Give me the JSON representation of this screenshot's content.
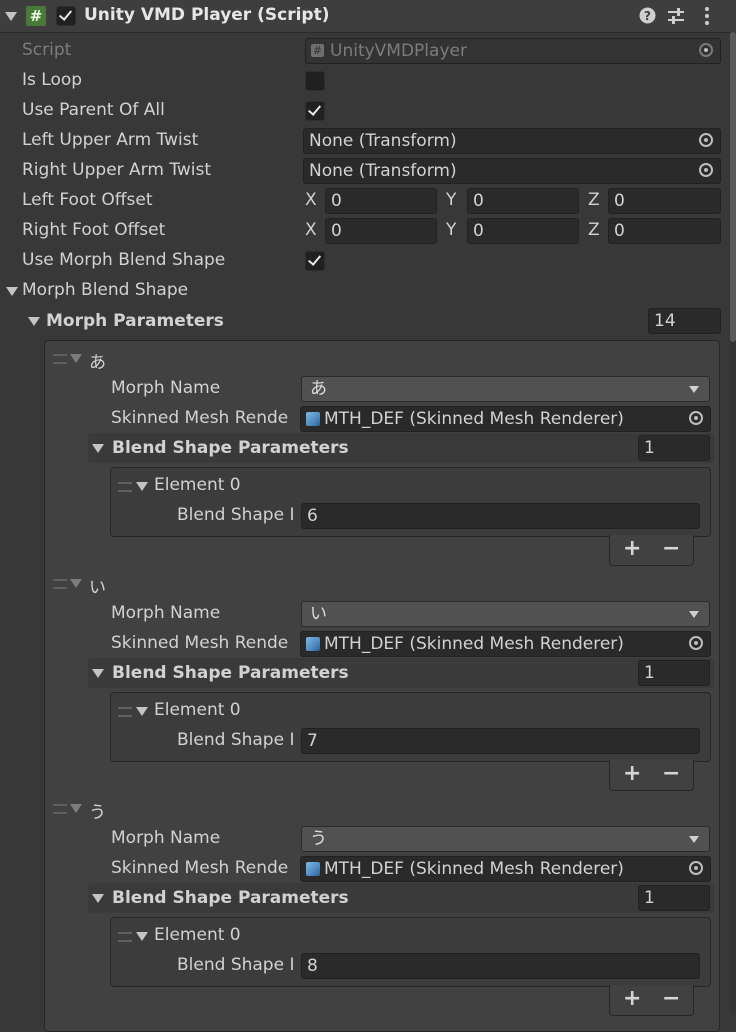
{
  "header": {
    "title": "Unity VMD Player (Script)",
    "script_glyph": "#",
    "enabled": true,
    "icons": [
      "help-icon",
      "preset-icon",
      "kebab-menu-icon"
    ]
  },
  "props": {
    "script": {
      "label": "Script",
      "value": "UnityVMDPlayer"
    },
    "is_loop": {
      "label": "Is Loop",
      "checked": false
    },
    "use_parent_of_all": {
      "label": "Use Parent Of All",
      "checked": true
    },
    "left_upper_arm_twist": {
      "label": "Left Upper Arm Twist",
      "value": "None (Transform)"
    },
    "right_upper_arm_twist": {
      "label": "Right Upper Arm Twist",
      "value": "None (Transform)"
    },
    "left_foot_offset": {
      "label": "Left Foot Offset",
      "x_label": "X",
      "y_label": "Y",
      "z_label": "Z",
      "x": "0",
      "y": "0",
      "z": "0"
    },
    "right_foot_offset": {
      "label": "Right Foot Offset",
      "x_label": "X",
      "y_label": "Y",
      "z_label": "Z",
      "x": "0",
      "y": "0",
      "z": "0"
    },
    "use_morph_blend_shape": {
      "label": "Use Morph Blend Shape",
      "checked": true
    },
    "morph_blend_shape": {
      "label": "Morph Blend Shape"
    },
    "morph_parameters": {
      "label": "Morph Parameters",
      "count": "14"
    }
  },
  "morphs": [
    {
      "title": "あ",
      "morph_name_label": "Morph Name",
      "morph_name": "あ",
      "mesh_label": "Skinned Mesh Rende",
      "mesh_value": "MTH_DEF (Skinned Mesh Renderer)",
      "bsp_label": "Blend Shape Parameters",
      "bsp_count": "1",
      "element_label": "Element 0",
      "blend_label": "Blend Shape I",
      "blend_value": "6"
    },
    {
      "title": "い",
      "morph_name_label": "Morph Name",
      "morph_name": "い",
      "mesh_label": "Skinned Mesh Rende",
      "mesh_value": "MTH_DEF (Skinned Mesh Renderer)",
      "bsp_label": "Blend Shape Parameters",
      "bsp_count": "1",
      "element_label": "Element 0",
      "blend_label": "Blend Shape I",
      "blend_value": "7"
    },
    {
      "title": "う",
      "morph_name_label": "Morph Name",
      "morph_name": "う",
      "mesh_label": "Skinned Mesh Rende",
      "mesh_value": "MTH_DEF (Skinned Mesh Renderer)",
      "bsp_label": "Blend Shape Parameters",
      "bsp_count": "1",
      "element_label": "Element 0",
      "blend_label": "Blend Shape I",
      "blend_value": "8"
    }
  ],
  "list_buttons": {
    "add": "+",
    "remove": "−"
  }
}
